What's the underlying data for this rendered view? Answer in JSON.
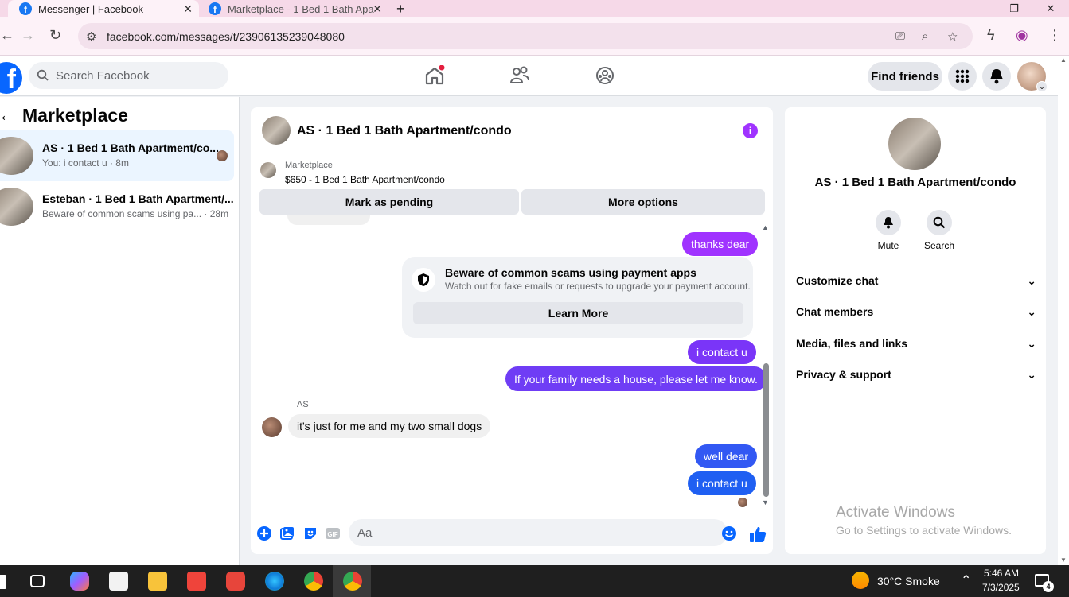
{
  "browser": {
    "tabs": [
      {
        "title": "Messenger | Facebook",
        "active": true
      },
      {
        "title": "Marketplace - 1 Bed 1 Bath Apa",
        "active": false
      }
    ],
    "new_tab": "+",
    "url": "facebook.com/messages/t/23906135239048080"
  },
  "header": {
    "search_placeholder": "Search Facebook",
    "find_friends": "Find friends"
  },
  "left": {
    "title": "Marketplace",
    "conversations": [
      {
        "title": "AS · 1 Bed 1 Bath Apartment/co...",
        "preview": "You: i contact u · 8m",
        "selected": true
      },
      {
        "title": "Esteban · 1 Bed 1 Bath Apartment/...",
        "preview": "Beware of common scams using pa... · 28m",
        "selected": false
      }
    ]
  },
  "chat": {
    "title": "AS · 1 Bed 1 Bath Apartment/condo",
    "marketplace_label": "Marketplace",
    "listing": "$650 - 1 Bed 1 Bath Apartment/condo",
    "mark_pending": "Mark as pending",
    "more_options": "More options",
    "messages": {
      "m1": "thanks dear",
      "m2": "i contact u",
      "m3": "If your family needs a house, please let me know.",
      "sender": "AS",
      "m4": "it's just for me and my two small dogs",
      "m5": "well dear",
      "m6": "i contact u"
    },
    "scam_notice": {
      "title": "Beware of common scams using payment apps",
      "subtitle": "Watch out for fake emails or requests to upgrade your payment account.",
      "button": "Learn More"
    },
    "composer_placeholder": "Aa",
    "colors": {
      "purple": "#a033ff",
      "violet": "#6f3df5",
      "blue": "#1f5ff2"
    }
  },
  "right": {
    "title": "AS · 1 Bed 1 Bath Apartment/condo",
    "mute": "Mute",
    "search": "Search",
    "sections": [
      "Customize chat",
      "Chat members",
      "Media, files and links",
      "Privacy & support"
    ]
  },
  "watermark": {
    "line1": "Activate Windows",
    "line2": "Go to Settings to activate Windows."
  },
  "taskbar": {
    "weather": "30°C  Smoke",
    "time": "5:46 AM",
    "date": "7/3/2025",
    "notifications": "4"
  }
}
